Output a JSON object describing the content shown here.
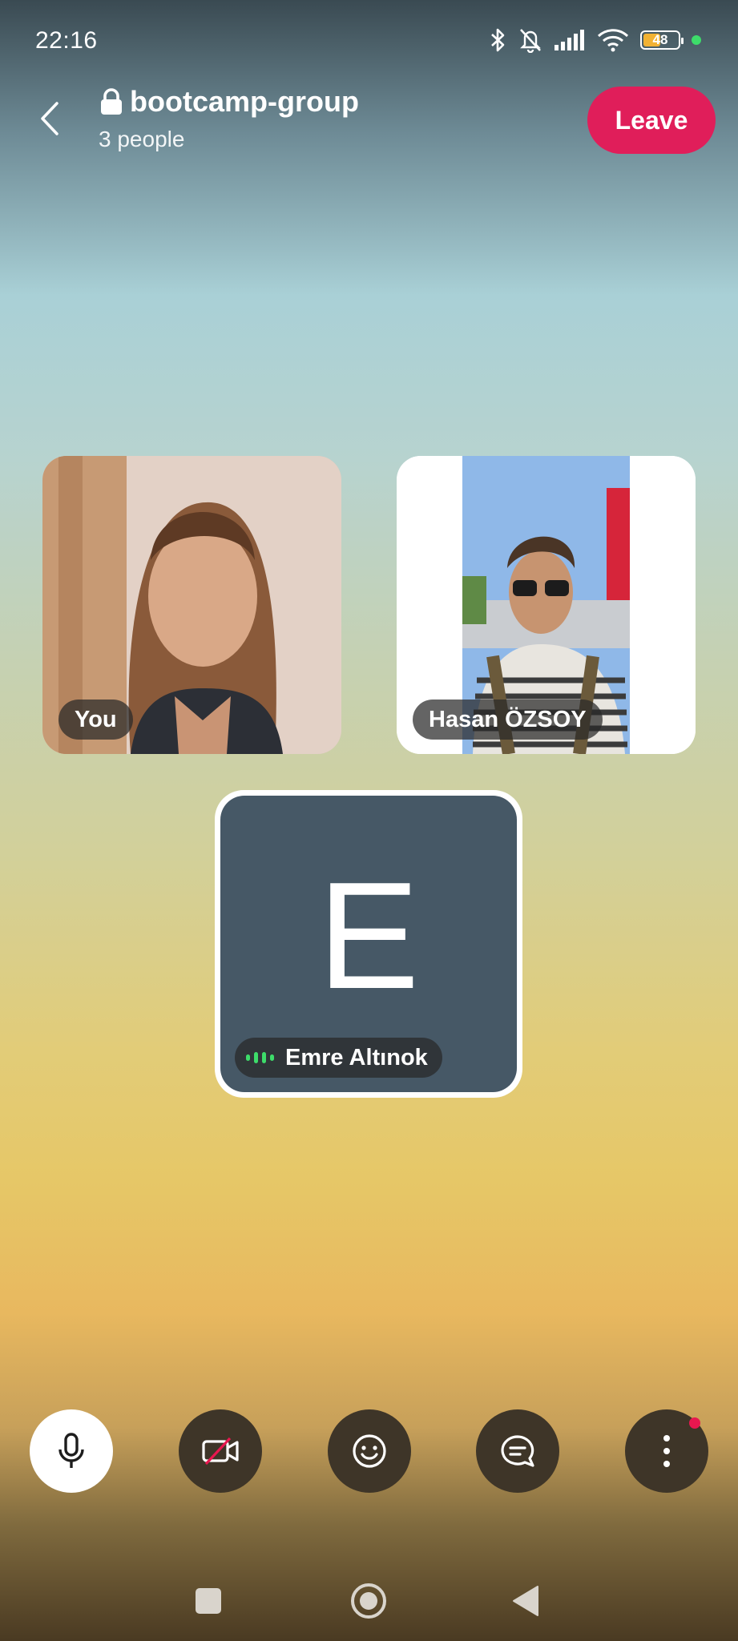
{
  "status_bar": {
    "time": "22:16",
    "battery_level": "48",
    "icons": [
      "bluetooth-icon",
      "muted-bell-icon",
      "signal-icon",
      "wifi-icon",
      "battery-icon",
      "active-dot"
    ]
  },
  "header": {
    "back_icon": "chevron-left-icon",
    "lock_icon": "lock-icon",
    "title": "bootcamp-group",
    "subtitle": "3 people",
    "leave_label": "Leave"
  },
  "participants": [
    {
      "name": "You",
      "type": "video"
    },
    {
      "name": "Hasan ÖZSOY",
      "type": "video"
    },
    {
      "name": "Emre Altınok",
      "type": "avatar",
      "initial": "E",
      "speaking": true
    }
  ],
  "controls": [
    {
      "icon": "microphone-icon",
      "active": true
    },
    {
      "icon": "camera-off-icon",
      "active": false
    },
    {
      "icon": "emoji-icon",
      "active": false
    },
    {
      "icon": "chat-icon",
      "active": false
    },
    {
      "icon": "more-icon",
      "active": false,
      "badge": true
    }
  ],
  "colors": {
    "leave": "#e01e5a",
    "speaking": "#3ddc6a",
    "avatar_bg": "#465866"
  }
}
